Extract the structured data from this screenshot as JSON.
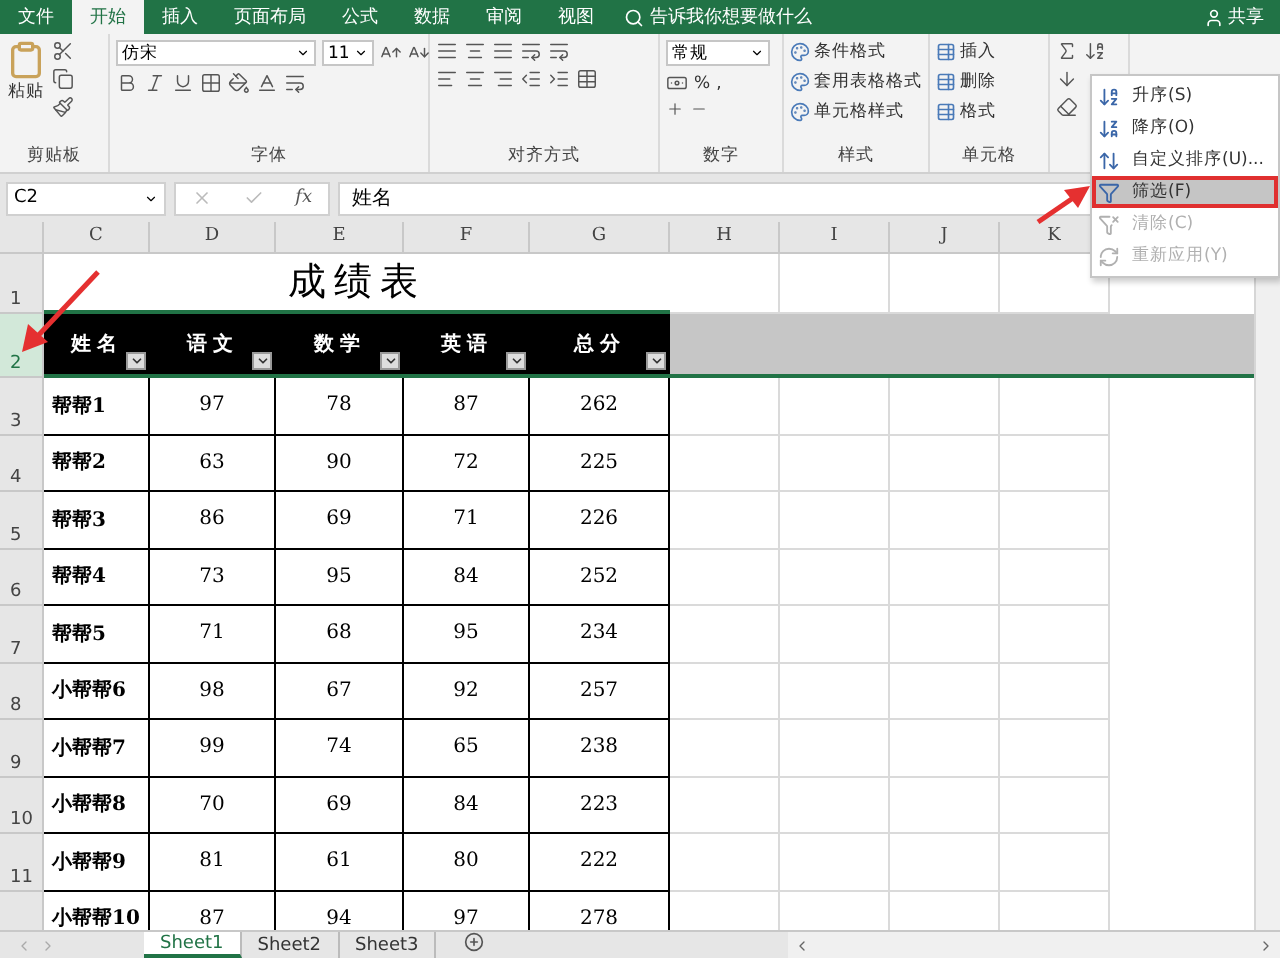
{
  "menu_tabs": [
    {
      "label": "文件",
      "selected": false
    },
    {
      "label": "开始",
      "selected": true
    },
    {
      "label": "插入",
      "selected": false
    },
    {
      "label": "页面布局",
      "selected": false
    },
    {
      "label": "公式",
      "selected": false
    },
    {
      "label": "数据",
      "selected": false
    },
    {
      "label": "审阅",
      "selected": false
    },
    {
      "label": "视图",
      "selected": false
    }
  ],
  "tell_me": "告诉我你想要做什么",
  "share": "共享",
  "ribbon": {
    "clipboard": {
      "paste": "粘贴",
      "label": "剪贴板"
    },
    "font": {
      "name": "仿宋",
      "size": "11",
      "label": "字体"
    },
    "alignment": {
      "label": "对齐方式"
    },
    "number": {
      "format": "常规",
      "percent": "%",
      "comma": ",",
      "label": "数字"
    },
    "styles": {
      "items": [
        "条件格式",
        "套用表格格式",
        "单元格样式"
      ],
      "label": "样式"
    },
    "cells": {
      "items": [
        "插入",
        "删除",
        "格式"
      ],
      "label": "单元格"
    }
  },
  "sort_menu": [
    {
      "label": "升序(S)",
      "kind": "asc",
      "selected": false,
      "disabled": false
    },
    {
      "label": "降序(O)",
      "kind": "desc",
      "selected": false,
      "disabled": false
    },
    {
      "label": "自定义排序(U)...",
      "kind": "custom",
      "selected": false,
      "disabled": false
    },
    {
      "label": "筛选(F)",
      "kind": "filter",
      "selected": true,
      "disabled": false
    },
    {
      "label": "清除(C)",
      "kind": "clear",
      "selected": false,
      "disabled": true
    },
    {
      "label": "重新应用(Y)",
      "kind": "reapply",
      "selected": false,
      "disabled": true
    }
  ],
  "formula_bar": {
    "cell_ref": "C2",
    "fx": "fx",
    "content": "姓名"
  },
  "sheet": {
    "columns": [
      "C",
      "D",
      "E",
      "F",
      "G",
      "H",
      "I",
      "J",
      "K"
    ],
    "row_numbers": [
      {
        "label": "1",
        "selected": false
      },
      {
        "label": "2",
        "selected": true
      },
      {
        "label": "3",
        "selected": false
      },
      {
        "label": "4",
        "selected": false
      },
      {
        "label": "5",
        "selected": false
      },
      {
        "label": "6",
        "selected": false
      },
      {
        "label": "7",
        "selected": false
      },
      {
        "label": "8",
        "selected": false
      },
      {
        "label": "9",
        "selected": false
      },
      {
        "label": "10",
        "selected": false
      },
      {
        "label": "11",
        "selected": false
      }
    ],
    "title": "成绩表",
    "headers": [
      "姓名",
      "语文",
      "数学",
      "英语",
      "总分"
    ],
    "rows": [
      [
        "帮帮1",
        "97",
        "78",
        "87",
        "262"
      ],
      [
        "帮帮2",
        "63",
        "90",
        "72",
        "225"
      ],
      [
        "帮帮3",
        "86",
        "69",
        "71",
        "226"
      ],
      [
        "帮帮4",
        "73",
        "95",
        "84",
        "252"
      ],
      [
        "帮帮5",
        "71",
        "68",
        "95",
        "234"
      ],
      [
        "小帮帮6",
        "98",
        "67",
        "92",
        "257"
      ],
      [
        "小帮帮7",
        "99",
        "74",
        "65",
        "238"
      ],
      [
        "小帮帮8",
        "70",
        "69",
        "84",
        "223"
      ],
      [
        "小帮帮9",
        "81",
        "61",
        "80",
        "222"
      ],
      [
        "小帮帮10",
        "87",
        "94",
        "97",
        "278"
      ]
    ]
  },
  "sheet_tabs": [
    {
      "label": "Sheet1",
      "selected": true
    },
    {
      "label": "Sheet2",
      "selected": false
    },
    {
      "label": "Sheet3",
      "selected": false
    }
  ]
}
